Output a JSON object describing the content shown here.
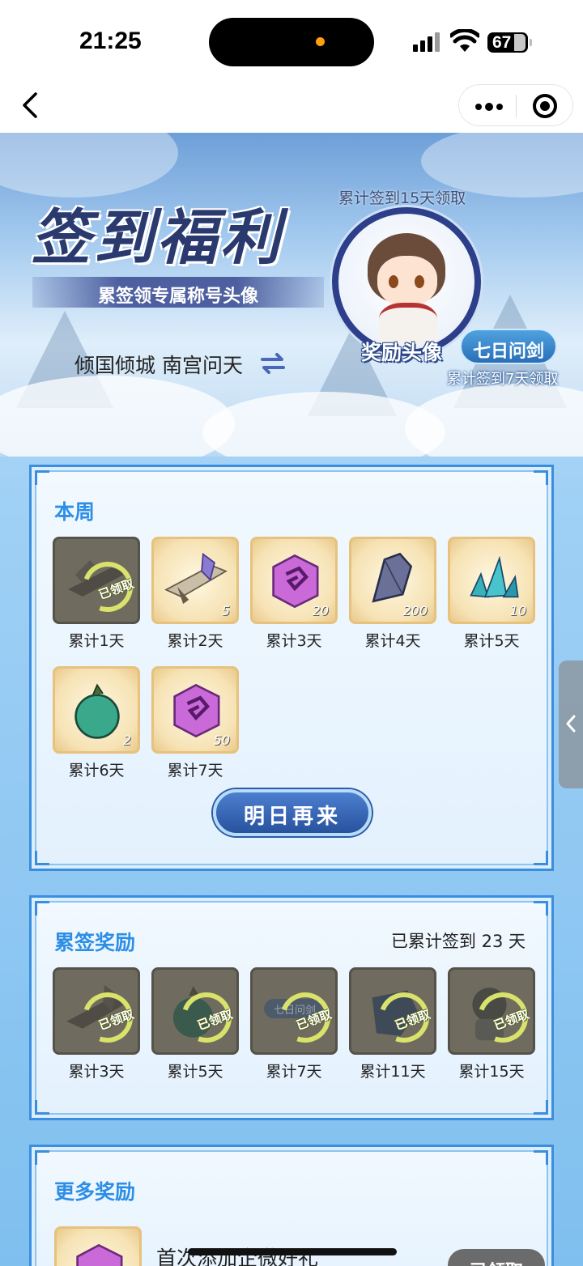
{
  "status_bar": {
    "time": "21:25",
    "battery": "67"
  },
  "nav": {
    "back_icon": "chevron-left-icon",
    "more_icon": "more-dots-icon",
    "close_icon": "target-close-icon"
  },
  "hero": {
    "title": "签到福利",
    "subtitle": "累签领专属称号头像",
    "note_15_days": "累计签到15天领取",
    "avatar_label": "奖励头像",
    "title_badge": "七日问剑",
    "note_7_days": "累计签到7天领取",
    "user_line": "倾国倾城 南宫问天",
    "switch_icon": "switch-arrows-icon"
  },
  "weekly": {
    "title": "本周",
    "claimed_label": "已领取",
    "items": [
      {
        "caption": "累计1天",
        "count": "",
        "claimed": true
      },
      {
        "caption": "累计2天",
        "count": "5",
        "claimed": false
      },
      {
        "caption": "累计3天",
        "count": "20",
        "claimed": false
      },
      {
        "caption": "累计4天",
        "count": "200",
        "claimed": false
      },
      {
        "caption": "累计5天",
        "count": "10",
        "claimed": false
      },
      {
        "caption": "累计6天",
        "count": "2",
        "claimed": false
      },
      {
        "caption": "累计7天",
        "count": "50",
        "claimed": false
      }
    ],
    "button": "明日再来"
  },
  "cumulative": {
    "title": "累签奖励",
    "summary": "已累计签到 23 天",
    "claimed_label": "已领取",
    "items": [
      {
        "caption": "累计3天"
      },
      {
        "caption": "累计5天"
      },
      {
        "caption": "累计7天",
        "tile_text": "七日问剑"
      },
      {
        "caption": "累计11天"
      },
      {
        "caption": "累计15天"
      }
    ]
  },
  "more": {
    "title": "更多奖励",
    "item_name": "首次添加企微好礼",
    "item_button": "已领取"
  },
  "colors": {
    "accent": "#2d8ee6",
    "panel_border": "#3a8ee0",
    "cta": "#27529e",
    "gold_tile": "#f6e2b4"
  }
}
